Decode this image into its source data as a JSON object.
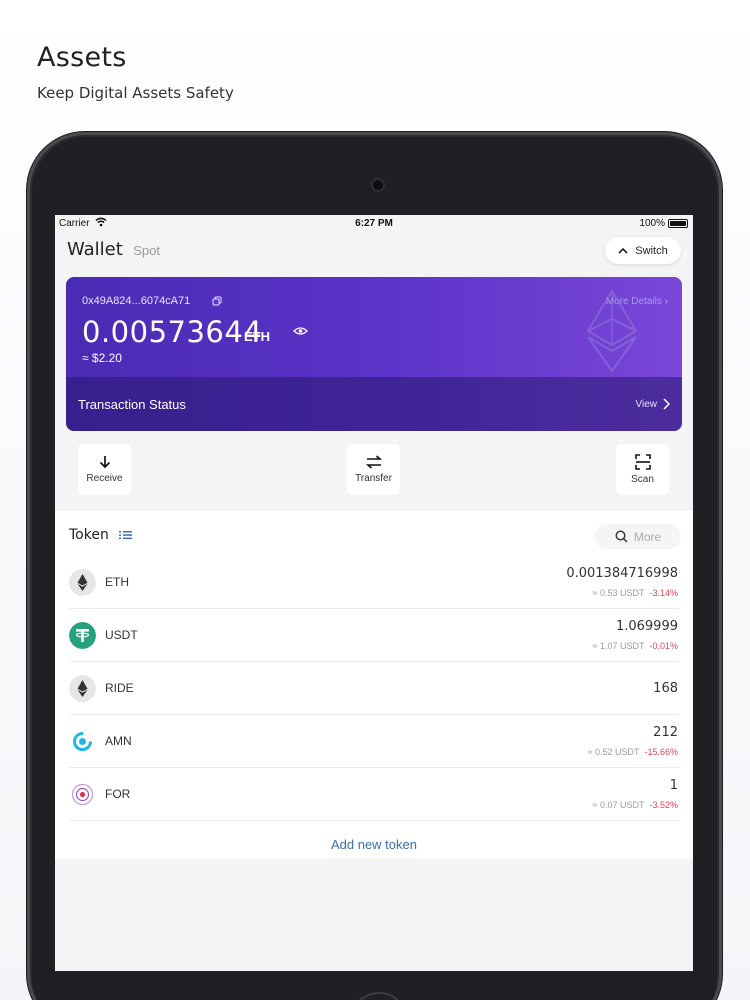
{
  "promo": {
    "title": "Assets",
    "subtitle": "Keep Digital Assets Safety"
  },
  "status_bar": {
    "carrier": "Carrier",
    "time": "6:27 PM",
    "battery": "100%"
  },
  "header": {
    "title": "Wallet",
    "tab": "Spot",
    "switch_label": "Switch"
  },
  "card": {
    "address": "0x49A824...6074cA71",
    "more_details": "More Details",
    "balance": "0.00573644",
    "unit": "ETH",
    "fiat": "≈ $2.20",
    "tx_status": "Transaction Status",
    "view": "View"
  },
  "actions": [
    {
      "label": "Receive",
      "icon": "arrow-down-icon"
    },
    {
      "label": "Transfer",
      "icon": "swap-icon"
    },
    {
      "label": "Scan",
      "icon": "scan-icon"
    }
  ],
  "token_section": {
    "title": "Token",
    "search_placeholder": "More",
    "add_label": "Add new token"
  },
  "tokens": [
    {
      "symbol": "ETH",
      "amount": "0.001384716998",
      "usdt": "≈ 0.53 USDT",
      "change": "-3.14%"
    },
    {
      "symbol": "USDT",
      "amount": "1.069999",
      "usdt": "≈ 1.07 USDT",
      "change": "-0.01%"
    },
    {
      "symbol": "RIDE",
      "amount": "168",
      "usdt": "",
      "change": ""
    },
    {
      "symbol": "AMN",
      "amount": "212",
      "usdt": "≈ 0.52 USDT",
      "change": "-15.66%"
    },
    {
      "symbol": "FOR",
      "amount": "1",
      "usdt": "≈ 0.07 USDT",
      "change": "-3.52%"
    }
  ],
  "colors": {
    "card_start": "#4a2bb3",
    "card_end": "#7a47d8",
    "negative": "#e04757",
    "link": "#3a6fb0",
    "usdt_green": "#26a17b",
    "amn_cyan": "#1fb6e8"
  }
}
